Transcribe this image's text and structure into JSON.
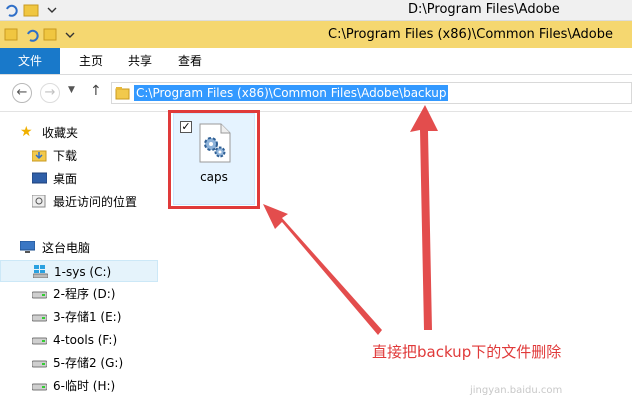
{
  "behind_window": {
    "title": "D:\\Program Files\\Adobe"
  },
  "window": {
    "title": "C:\\Program Files (x86)\\Common Files\\Adobe"
  },
  "ribbon": {
    "tabs": [
      "文件",
      "主页",
      "共享",
      "查看"
    ]
  },
  "navigation": {
    "back_icon": "back-arrow-icon",
    "forward_icon": "forward-arrow-icon",
    "up_icon": "up-arrow-icon",
    "address_path": "C:\\Program Files (x86)\\Common Files\\Adobe\\backup"
  },
  "sidebar": {
    "favorites": {
      "label": "收藏夹",
      "items": [
        "下载",
        "桌面",
        "最近访问的位置"
      ]
    },
    "this_pc": {
      "label": "这台电脑",
      "drives": [
        "1-sys (C:)",
        "2-程序 (D:)",
        "3-存储1 (E:)",
        "4-tools (F:)",
        "5-存储2 (G:)",
        "6-临时 (H:)"
      ]
    }
  },
  "content": {
    "files": [
      {
        "name": "caps",
        "checked": true
      }
    ]
  },
  "annotation": {
    "text": "直接把backup下的文件删除",
    "color": "#e03a3a"
  },
  "watermark": {
    "text": "jingyan.baidu.com"
  },
  "colors": {
    "titlebar": "#f5d770",
    "file_tab": "#1979ca",
    "selection": "#3399ff",
    "annotation": "#e03a3a"
  }
}
